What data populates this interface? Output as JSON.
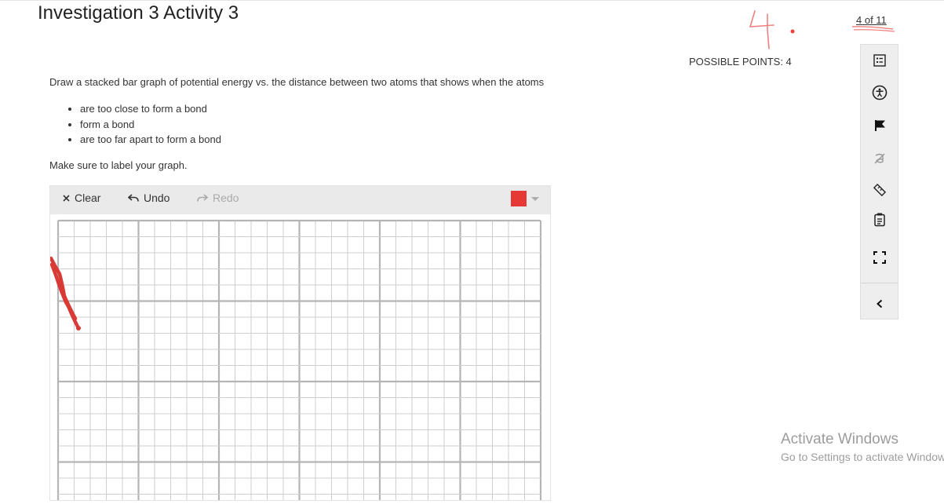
{
  "header": {
    "title": "Investigation 3 Activity 3",
    "handwritten_mark": "4.",
    "page_counter": "4 of 11",
    "possible_points": "POSSIBLE POINTS: 4"
  },
  "question": {
    "prompt": "Draw a stacked bar graph of potential energy vs. the distance between two atoms that shows when the atoms",
    "bullets": [
      "are too close to form a bond",
      "form a bond",
      "are too far apart to form a bond"
    ],
    "note": "Make sure to label your graph."
  },
  "drawing_tool": {
    "clear_label": "Clear",
    "undo_label": "Undo",
    "redo_label": "Redo",
    "selected_color": "#e53935",
    "stroke_color": "#d93a35"
  },
  "side_toolbar": {
    "icons": [
      "list-icon",
      "accessibility-icon",
      "flag-icon",
      "strikethrough-icon",
      "ruler-icon",
      "notepad-icon",
      "fullscreen-icon",
      "collapse-chevron-icon"
    ]
  },
  "watermark": {
    "title": "Activate Windows",
    "subtitle": "Go to Settings to activate Windows."
  },
  "colors": {
    "accent_red": "#e53935",
    "toolbar_bg": "#eaeaea",
    "grid_minor": "#cfcfcf",
    "grid_major": "#b5b5b5"
  }
}
